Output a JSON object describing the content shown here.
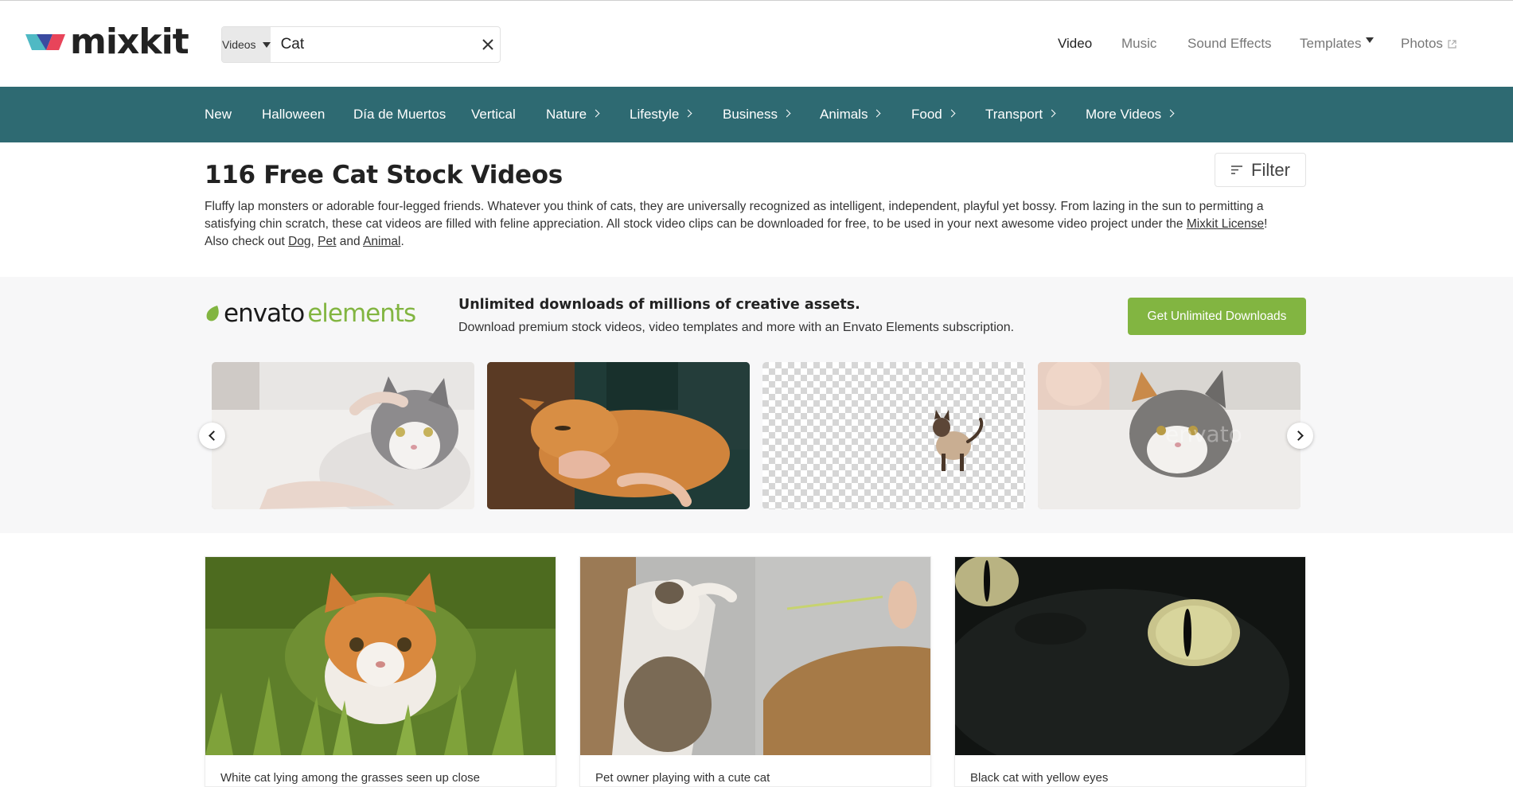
{
  "brand": {
    "name": "mixkit"
  },
  "search": {
    "type_label": "Videos",
    "query": "Cat"
  },
  "top_nav": {
    "video": "Video",
    "music": "Music",
    "sound_effects": "Sound Effects",
    "templates": "Templates",
    "photos": "Photos"
  },
  "categories": {
    "new": "New",
    "halloween": "Halloween",
    "dia_de_muertos": "Día de Muertos",
    "vertical": "Vertical",
    "nature": "Nature",
    "lifestyle": "Lifestyle",
    "business": "Business",
    "animals": "Animals",
    "food": "Food",
    "transport": "Transport",
    "more_videos": "More Videos"
  },
  "page": {
    "title": "116 Free Cat Stock Videos",
    "filter_label": "Filter",
    "description_part1": "Fluffy lap monsters or adorable four-legged friends. Whatever you think of cats, they are universally recognized as intelligent, independent, playful yet bossy. From lazing in the sun to permitting a satisfying chin scratch, these cat videos are filled with feline appreciation. All stock video clips can be downloaded for free, to be used in your next awesome video project under the ",
    "license_link": "Mixkit License",
    "description_part2": "! Also check out ",
    "link_dog": "Dog",
    "sep_comma": ", ",
    "link_pet": "Pet",
    "sep_and": " and ",
    "link_animal": "Animal",
    "period": "."
  },
  "promo": {
    "logo_part1": "envato",
    "logo_part2": "elements",
    "headline": "Unlimited downloads of millions of creative assets.",
    "subline": "Download premium stock videos, video templates and more with an Envato Elements subscription.",
    "cta": "Get Unlimited Downloads"
  },
  "videos": [
    {
      "title": "White cat lying among the grasses seen up close"
    },
    {
      "title": "Pet owner playing with a cute cat"
    },
    {
      "title": "Black cat with yellow eyes"
    }
  ],
  "colors": {
    "category_bar": "#2e6a72",
    "envato_green": "#82b541"
  }
}
